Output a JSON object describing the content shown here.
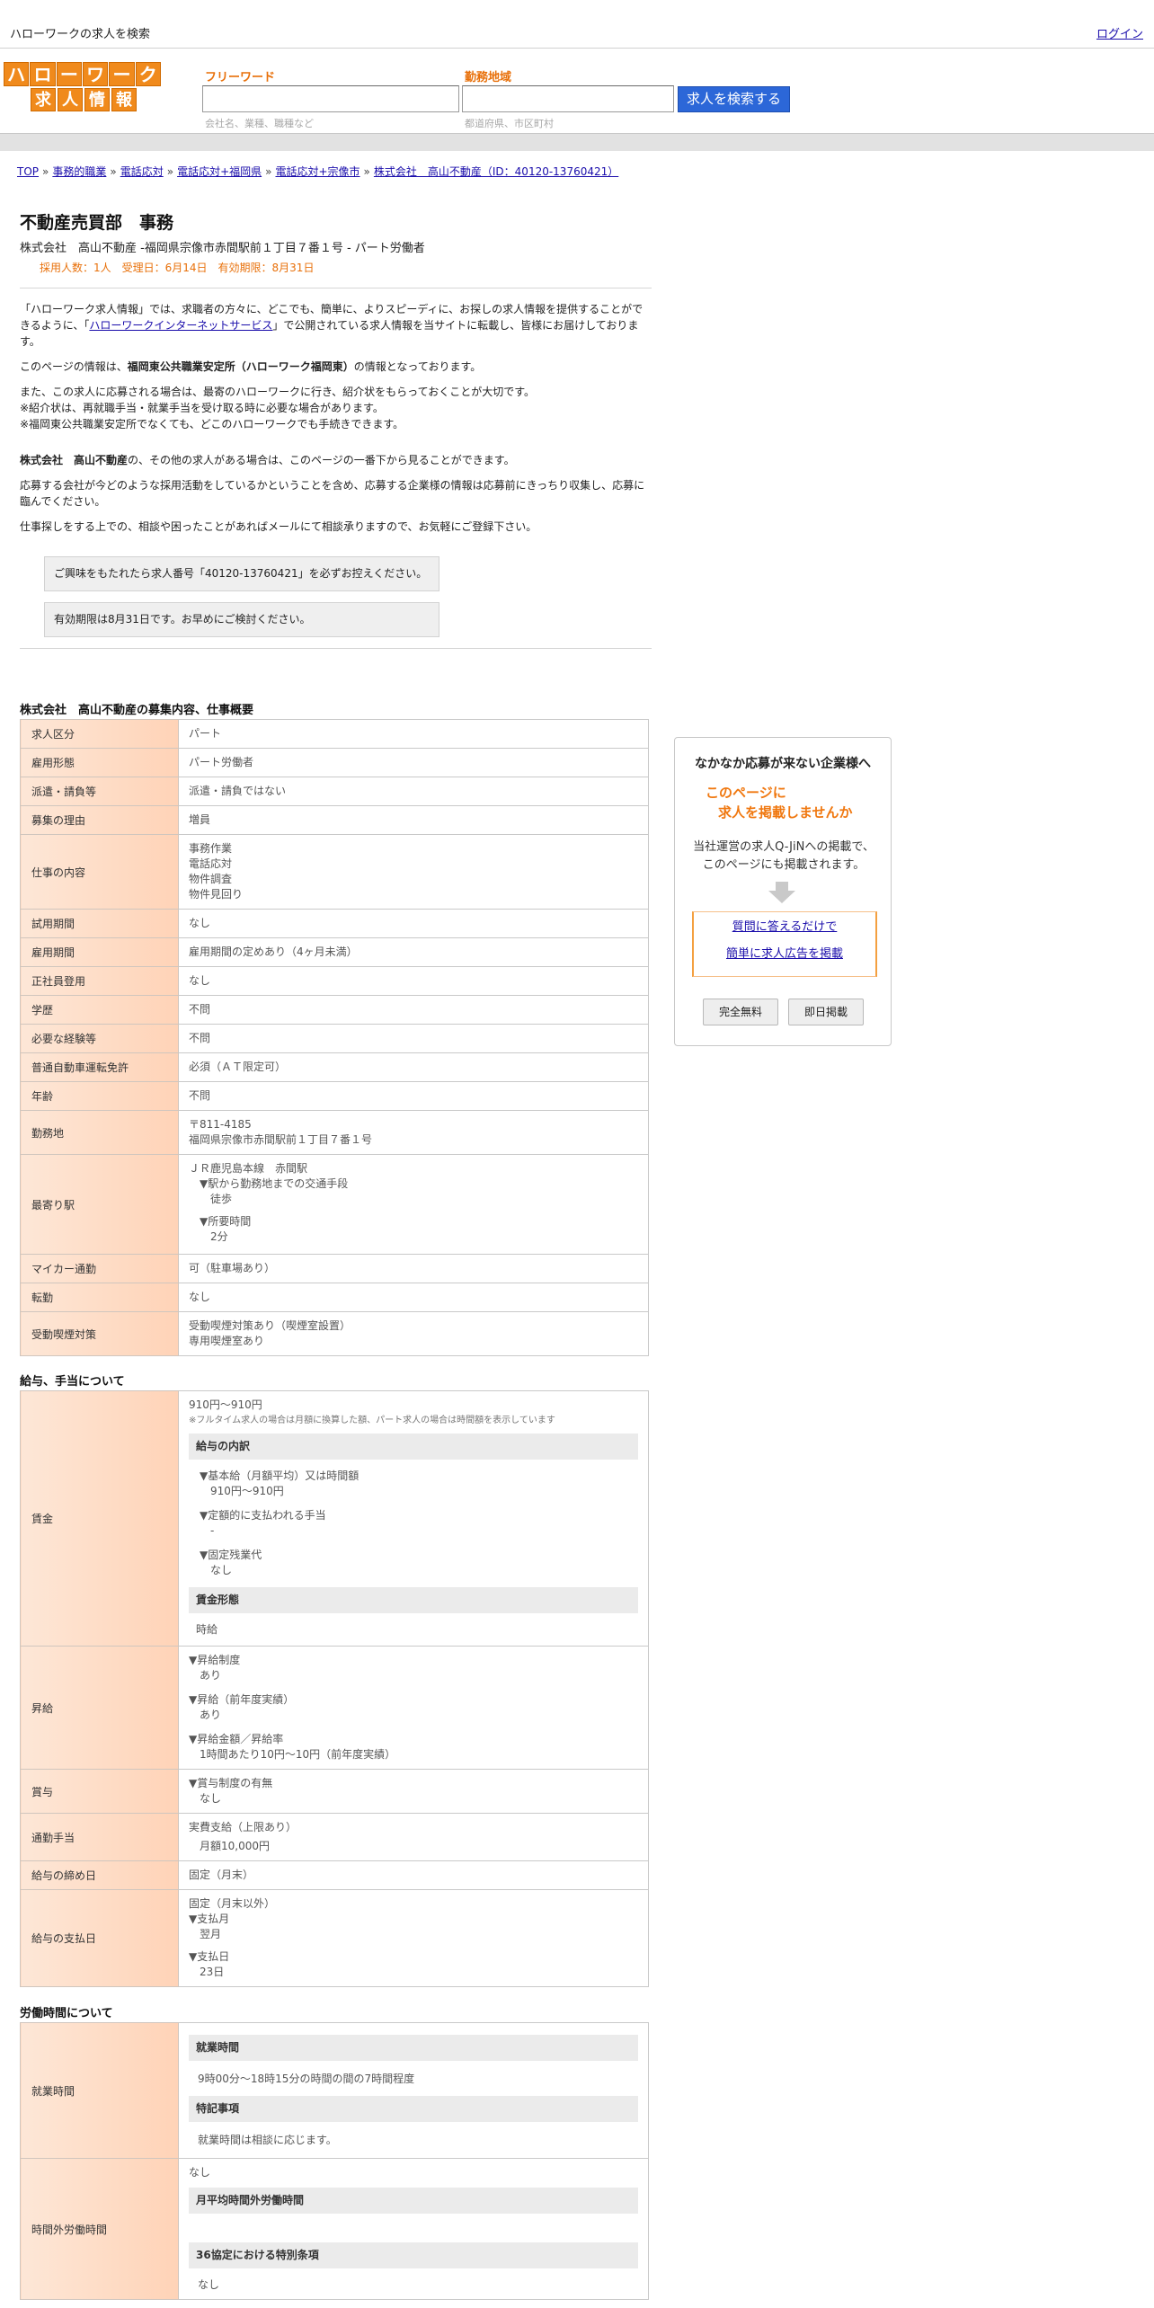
{
  "topbar": {
    "site_title": "ハローワークの求人を検索",
    "login": "ログイン"
  },
  "logo": {
    "row1": [
      "ハ",
      "ロ",
      "ー",
      "ワ",
      "ー",
      "ク"
    ],
    "row2": [
      "求",
      "人",
      "情",
      "報"
    ]
  },
  "search": {
    "freeword_label": "フリーワード",
    "freeword_hint": "会社名、業種、職種など",
    "area_label": "勤務地域",
    "area_hint": "都道府県、市区町村",
    "button": "求人を検索する"
  },
  "breadcrumb": [
    "TOP",
    "事務的職業",
    "電話応対",
    "電話応対+福岡県",
    "電話応対+宗像市",
    "株式会社　高山不動産（ID：40120-13760421）"
  ],
  "job": {
    "title": "不動産売買部　事務",
    "subtitle": "株式会社　高山不動産 -福岡県宗像市赤間駅前１丁目７番１号 - パート労働者",
    "meta": "採用人数：1人　受理日：6月14日　有効期限：8月31日"
  },
  "intro": {
    "p1_a": "「ハローワーク求人情報」では、求職者の方々に、どこでも、簡単に、よりスピーディに、お探しの求人情報を提供することができるように、「",
    "p1_link": "ハローワークインターネットサービス",
    "p1_b": "」で公開されている求人情報を当サイトに転載し、皆様にお届けしております。",
    "p2_a": "このページの情報は、",
    "p2_bold": "福岡東公共職業安定所（ハローワーク福岡東）",
    "p2_b": "の情報となっております。",
    "p3_1": "また、この求人に応募される場合は、最寄のハローワークに行き、紹介状をもらっておくことが大切です。",
    "p3_2": "※紹介状は、再就職手当・就業手当を受け取る時に必要な場合があります。",
    "p3_3": "※福岡東公共職業安定所でなくても、どこのハローワークでも手続きできます。",
    "p4_bold": "株式会社　高山不動産",
    "p4_b": "の、その他の求人がある場合は、このページの一番下から見ることができます。",
    "p5": "応募する会社が今どのような採用活動をしているかということを含め、応募する企業様の情報は応募前にきっちり収集し、応募に臨んでください。",
    "p6": "仕事探しをする上での、相談や困ったことがあればメールにて相談承りますので、お気軽にご登録下さい。",
    "notice1": "ご興味をもたれたら求人番号「40120-13760421」を必ずお控えください。",
    "notice2": "有効期限は8月31日です。お早めにご検討ください。"
  },
  "overview": {
    "title": "株式会社　高山不動産の募集内容、仕事概要",
    "rows": [
      {
        "k": "求人区分",
        "v": [
          "パート"
        ]
      },
      {
        "k": "雇用形態",
        "v": [
          "パート労働者"
        ]
      },
      {
        "k": "派遣・請負等",
        "v": [
          "派遣・請負ではない"
        ]
      },
      {
        "k": "募集の理由",
        "v": [
          "増員"
        ]
      },
      {
        "k": "仕事の内容",
        "v": [
          "事務作業",
          "電話応対",
          "物件調査",
          "物件見回り"
        ]
      },
      {
        "k": "試用期間",
        "v": [
          "なし"
        ]
      },
      {
        "k": "雇用期間",
        "v": [
          "雇用期間の定めあり（4ヶ月未満）"
        ]
      },
      {
        "k": "正社員登用",
        "v": [
          "なし"
        ]
      },
      {
        "k": "学歴",
        "v": [
          "不問"
        ]
      },
      {
        "k": "必要な経験等",
        "v": [
          "不問"
        ]
      },
      {
        "k": "普通自動車運転免許",
        "v": [
          "必須（ＡＴ限定可）"
        ]
      },
      {
        "k": "年齢",
        "v": [
          "不問"
        ]
      },
      {
        "k": "勤務地",
        "v": [
          "〒811-4185",
          "福岡県宗像市赤間駅前１丁目７番１号"
        ]
      }
    ],
    "nearest": {
      "k": "最寄り駅",
      "line": "ＪＲ鹿児島本線　赤間駅",
      "access_label": "▼駅から勤務地までの交通手段",
      "access": "徒歩",
      "time_label": "▼所要時間",
      "time": "2分"
    },
    "rows2": [
      {
        "k": "マイカー通勤",
        "v": [
          "可（駐車場あり）"
        ]
      },
      {
        "k": "転勤",
        "v": [
          "なし"
        ]
      },
      {
        "k": "受動喫煙対策",
        "v": [
          "受動喫煙対策あり（喫煙室設置）",
          "専用喫煙室あり"
        ]
      }
    ]
  },
  "salary": {
    "title": "給与、手当について",
    "wage_k": "賃金",
    "wage_range": "910円〜910円",
    "wage_note": "※フルタイム求人の場合は月額に換算した額、パート求人の場合は時間額を表示しています",
    "breakdown_head": "給与の内訳",
    "base_label": "▼基本給（月額平均）又は時間額",
    "base_val": "910円〜910円",
    "fixed_label": "▼定額的に支払われる手当",
    "fixed_val": "-",
    "overtime_label": "▼固定残業代",
    "overtime_val": "なし",
    "form_head": "賃金形態",
    "form_val": "時給",
    "raise_k": "昇給",
    "raise1_label": "▼昇給制度",
    "raise1_val": "あり",
    "raise2_label": "▼昇給（前年度実績）",
    "raise2_val": "あり",
    "raise3_label": "▼昇給金額／昇給率",
    "raise3_val": "1時間あたり10円〜10円（前年度実績）",
    "bonus_k": "賞与",
    "bonus_label": "▼賞与制度の有無",
    "bonus_val": "なし",
    "commute_k": "通勤手当",
    "commute_v1": "実費支給（上限あり）",
    "commute_v2": "月額10,000円",
    "cutoff_k": "給与の締め日",
    "cutoff_v": "固定（月末）",
    "payday_k": "給与の支払日",
    "payday_v": "固定（月末以外）",
    "paymonth_label": "▼支払月",
    "paymonth_val": "翌月",
    "payday_label": "▼支払日",
    "payday_val": "23日"
  },
  "hours": {
    "title": "労働時間について",
    "work_k": "就業時間",
    "work_head": "就業時間",
    "work_val": "9時00分〜18時15分の時間の間の7時間程度",
    "special_head": "特記事項",
    "special_val": "就業時間は相談に応じます。",
    "ot_k": "時間外労働時間",
    "ot_val": "なし",
    "ot_avg_head": "月平均時間外労働時間",
    "ot36_head": "36協定における特別条項",
    "ot36_val": "なし"
  },
  "sidebar": {
    "title": "なかなか応募が来ない企業様へ",
    "hl1": "このページに",
    "hl2": "求人を掲載しませんか",
    "desc1": "当社運営の求人Q-JiNへの掲載で、",
    "desc2": "このページにも掲載されます。",
    "link1": "質問に答えるだけで",
    "link2": "簡単に求人広告を掲載",
    "tag1": "完全無料",
    "tag2": "即日掲載"
  }
}
